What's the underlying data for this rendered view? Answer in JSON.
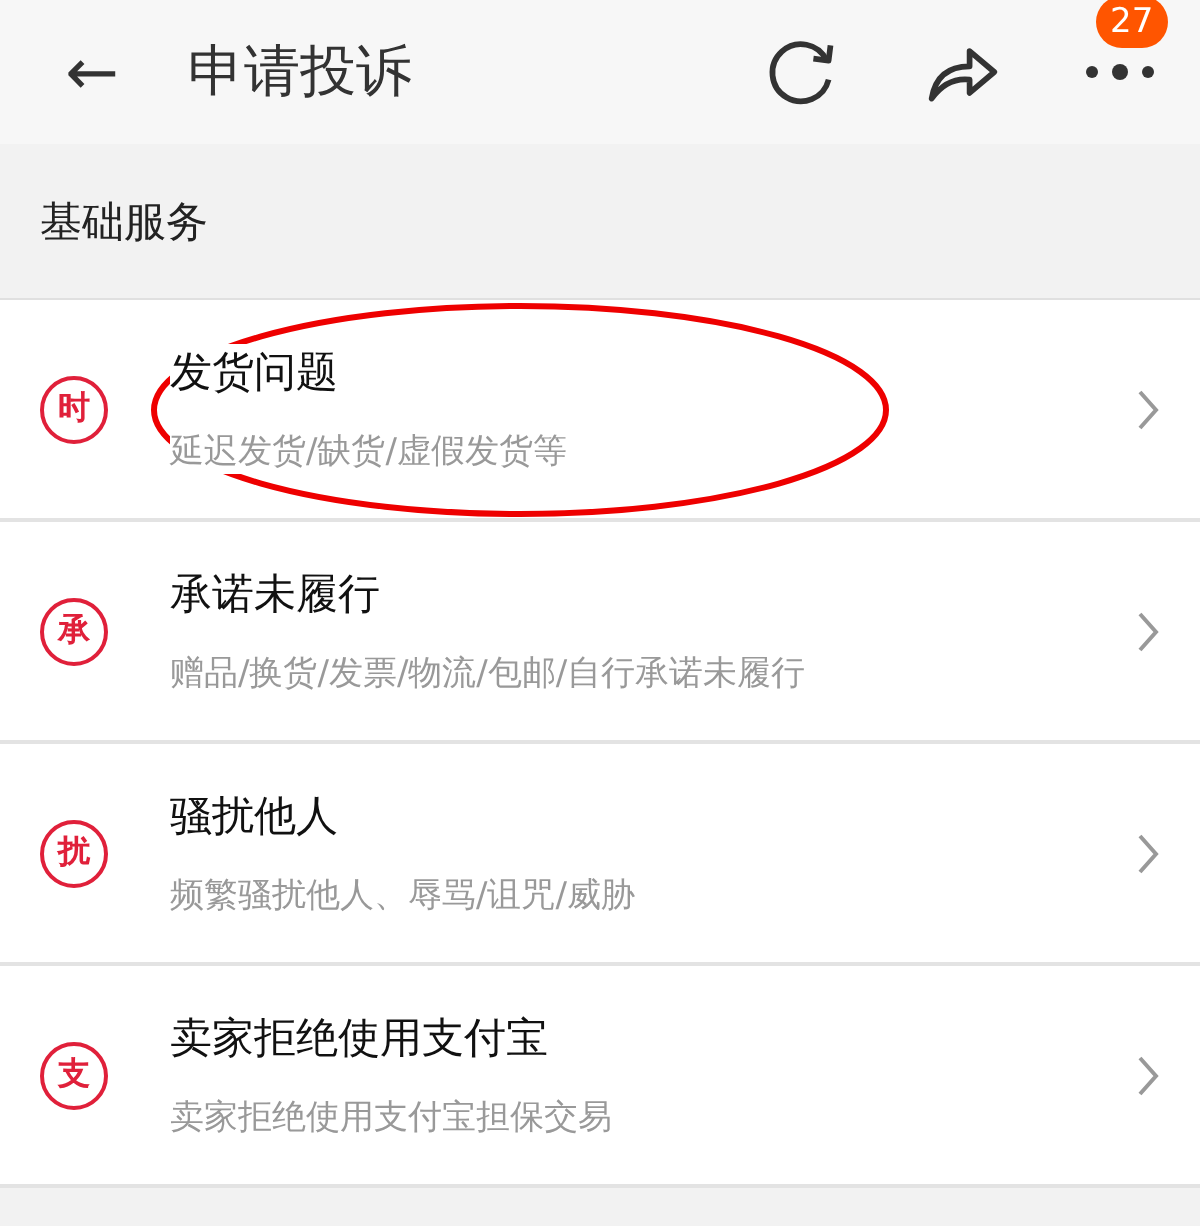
{
  "header": {
    "back_icon": "←",
    "title": "申请投诉",
    "badge": "27"
  },
  "section": {
    "title": "基础服务"
  },
  "items": [
    {
      "icon_char": "时",
      "title": "发货问题",
      "subtitle": "延迟发货/缺货/虚假发货等",
      "circled": true
    },
    {
      "icon_char": "承",
      "title": "承诺未履行",
      "subtitle": "赠品/换货/发票/物流/包邮/自行承诺未履行",
      "circled": false
    },
    {
      "icon_char": "扰",
      "title": "骚扰他人",
      "subtitle": "频繁骚扰他人、辱骂/诅咒/威胁",
      "circled": false
    },
    {
      "icon_char": "支",
      "title": "卖家拒绝使用支付宝",
      "subtitle": "卖家拒绝使用支付宝担保交易",
      "circled": false
    }
  ]
}
